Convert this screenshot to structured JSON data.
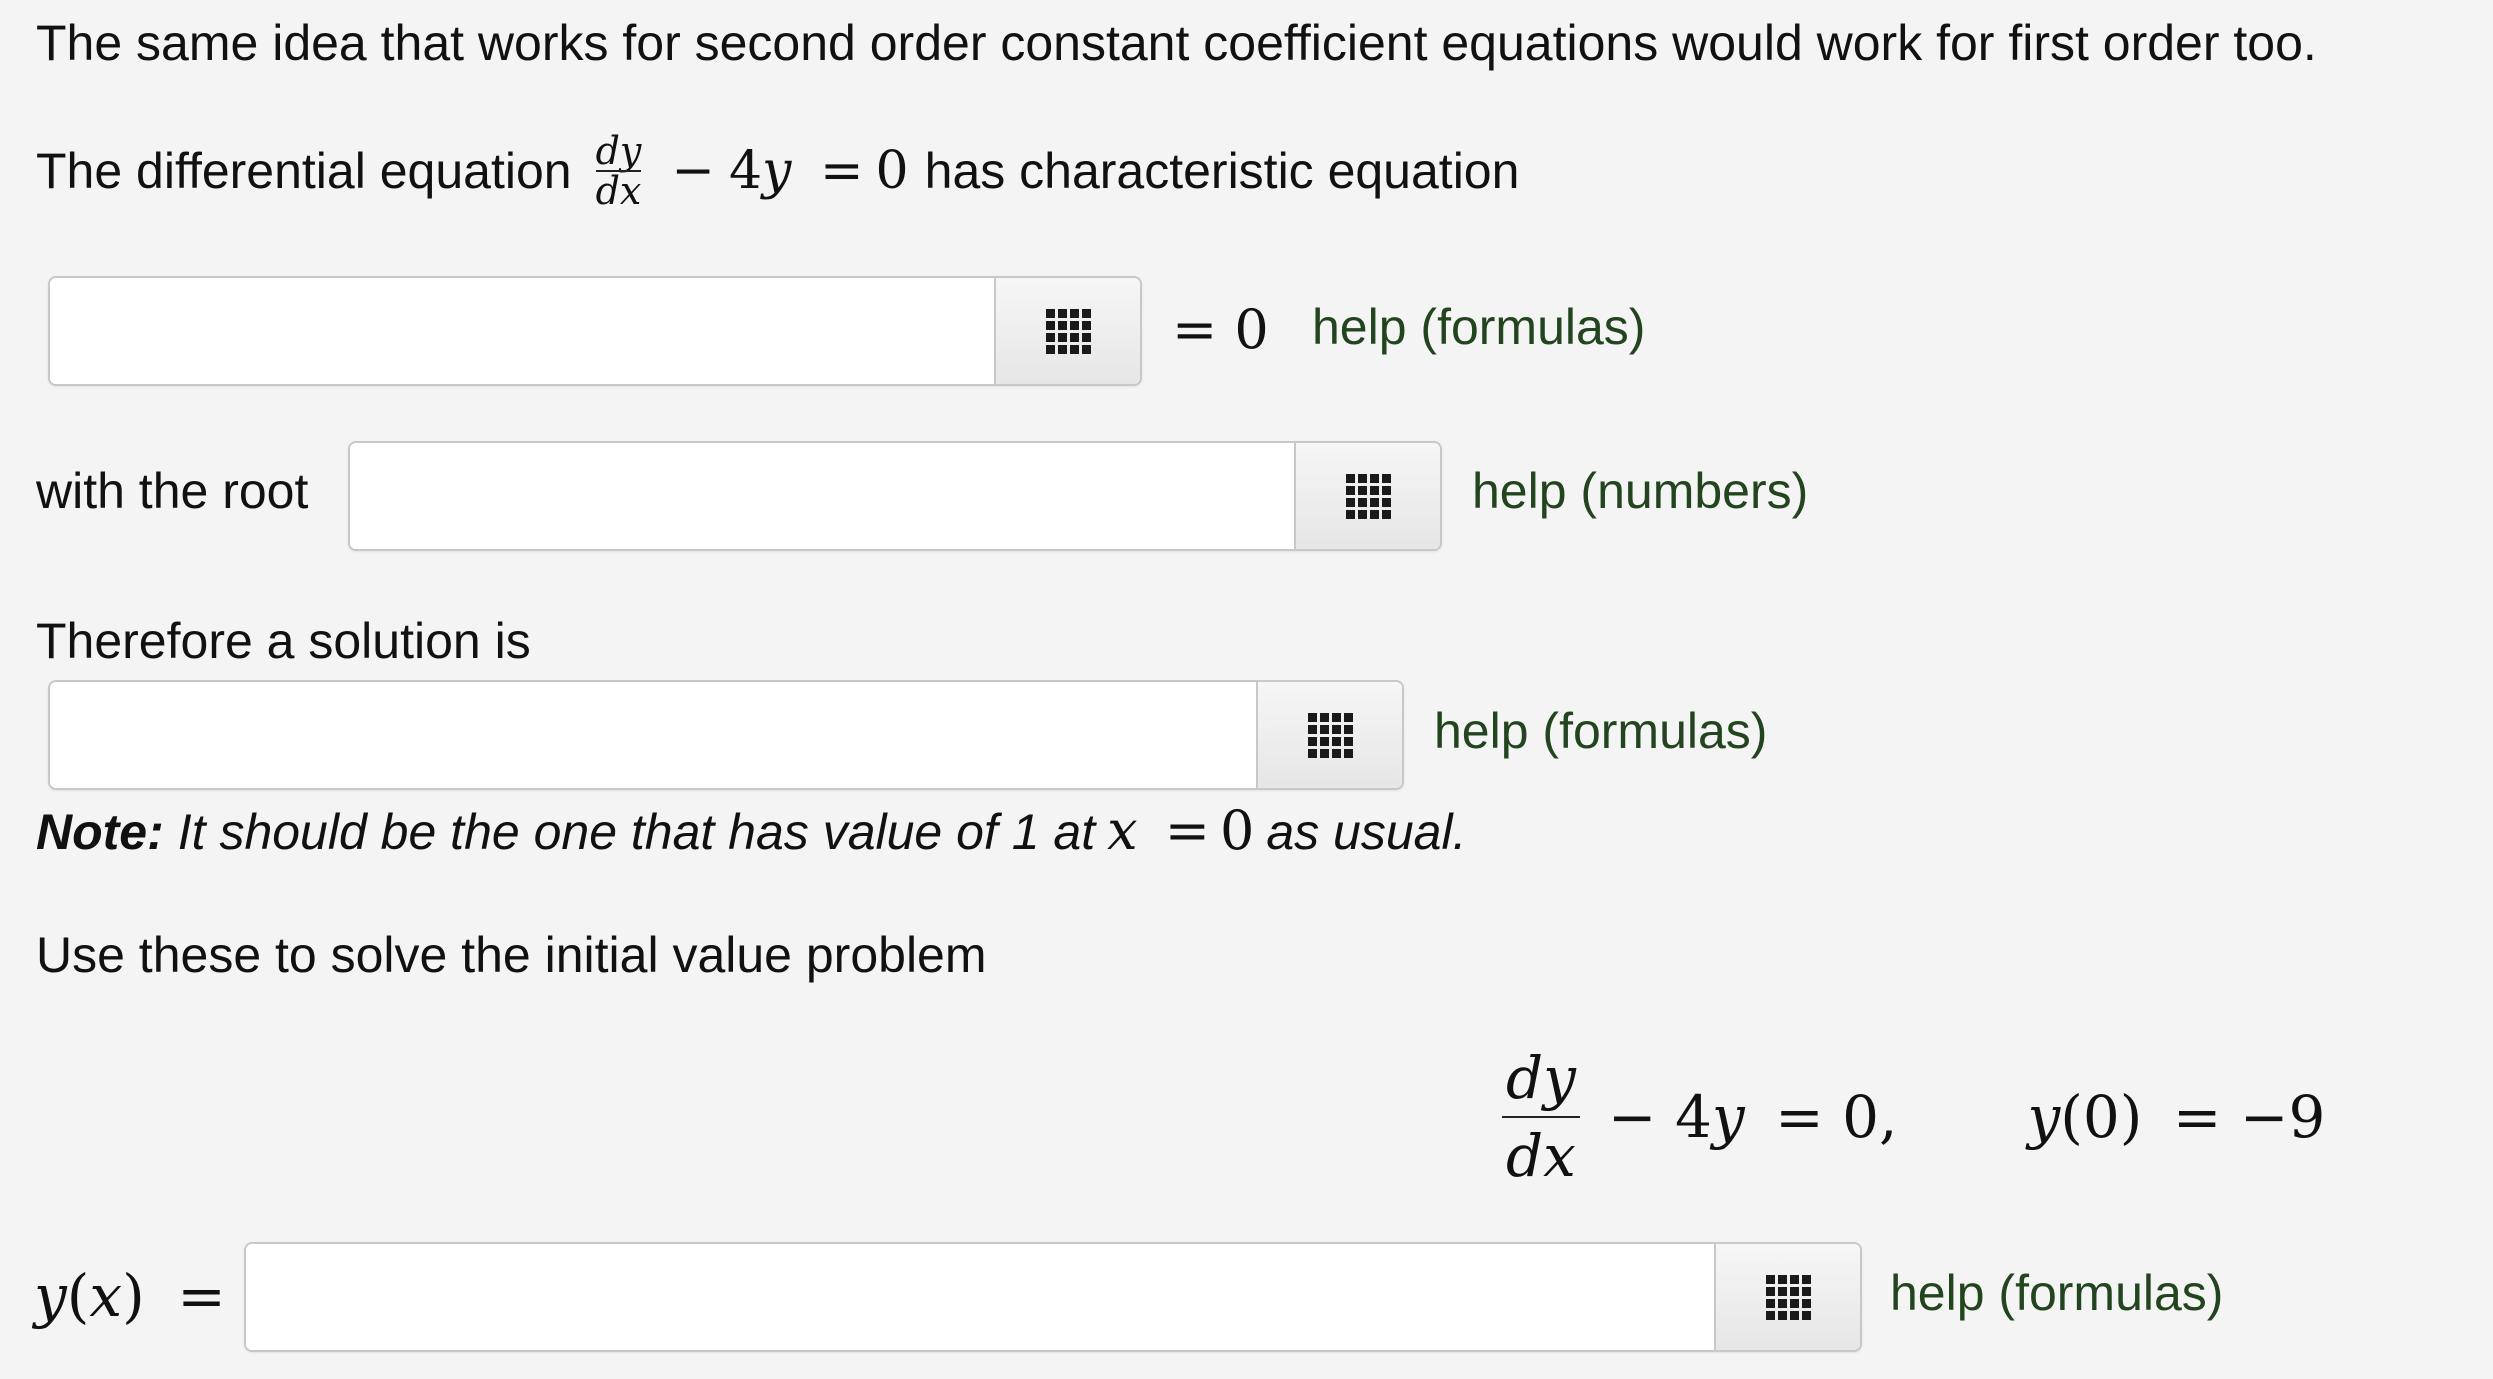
{
  "intro": "The same idea that works for second order constant coefficient equations would work for first order too.",
  "line2": {
    "prefix": "The differential equation",
    "frac_num": "dy",
    "frac_den": "dx",
    "rest_minus": "−",
    "coef": "4",
    "var": "y",
    "eq": "=",
    "zero": "0",
    "suffix": "has characteristic equation"
  },
  "char_eq": {
    "value": "",
    "eq_zero": "= 0",
    "help": "help (formulas)"
  },
  "root": {
    "label": "with the root",
    "value": "",
    "help": "help (numbers)"
  },
  "solution": {
    "label": "Therefore a solution is",
    "value": "",
    "help": "help (formulas)"
  },
  "note": {
    "bold": "Note:",
    "text1": "It should be the one that has value of 1 at",
    "x": "x",
    "eq": "=",
    "zero": "0",
    "text2": "as usual."
  },
  "ivp": {
    "label": "Use these to solve the initial value problem",
    "frac_num": "dy",
    "frac_den": "dx",
    "rest": "− 4",
    "rest_var": "y",
    "rest_end": "= 0,",
    "init_var": "y",
    "init_arg": "(0)",
    "init_end": "= −9"
  },
  "answer": {
    "label_y": "y",
    "label_open": "(",
    "label_x": "x",
    "label_close": ")",
    "label_eq": "=",
    "value": "",
    "help": "help (formulas)"
  },
  "icons": {
    "equation_editor": "grid-icon"
  }
}
